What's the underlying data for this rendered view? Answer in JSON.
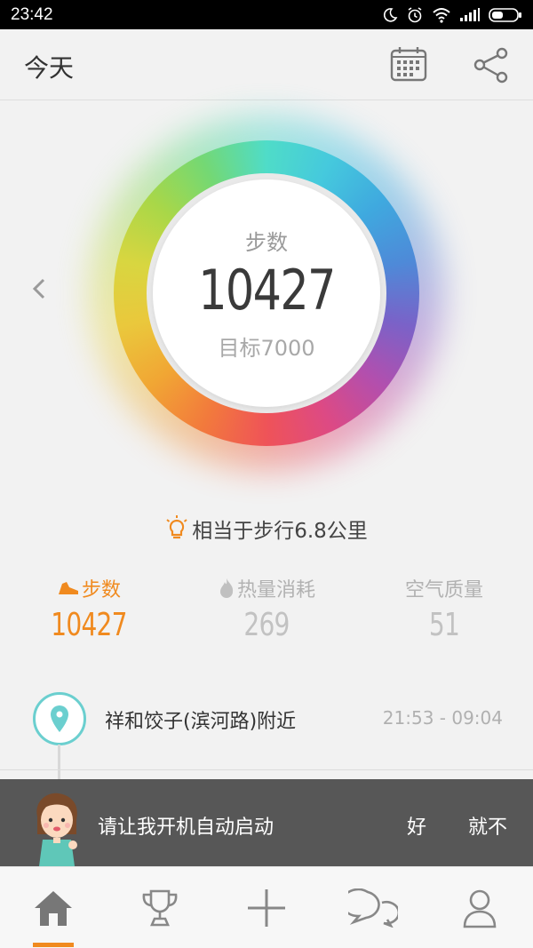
{
  "status_bar": {
    "time": "23:42"
  },
  "header": {
    "title": "今天",
    "calendar_icon": "calendar-icon",
    "share_icon": "share-icon"
  },
  "ring": {
    "label": "步数",
    "value": "10427",
    "goal": "目标7000"
  },
  "equivalence": {
    "text": "相当于步行6.8公里"
  },
  "stats": [
    {
      "label": "步数",
      "value": "10427",
      "icon": "shoe-icon",
      "active": true
    },
    {
      "label": "热量消耗",
      "value": "269",
      "icon": "flame-icon",
      "active": false
    },
    {
      "label": "空气质量",
      "value": "51",
      "icon": "",
      "active": false
    }
  ],
  "timeline": [
    {
      "title": "祥和饺子(滨河路)附近",
      "time": "21:53 - 09:04"
    }
  ],
  "toast": {
    "message": "请让我开机自动启动",
    "ok_label": "好",
    "no_label": "就不"
  },
  "bottom_nav": [
    {
      "icon": "home-icon",
      "active": true
    },
    {
      "icon": "trophy-icon",
      "active": false
    },
    {
      "icon": "plus-icon",
      "active": false
    },
    {
      "icon": "chat-icon",
      "active": false
    },
    {
      "icon": "profile-icon",
      "active": false
    }
  ],
  "colors": {
    "accent": "#f08a1f",
    "pin": "#6bcfcf",
    "text": "#333333",
    "muted": "#b2b2b2"
  }
}
